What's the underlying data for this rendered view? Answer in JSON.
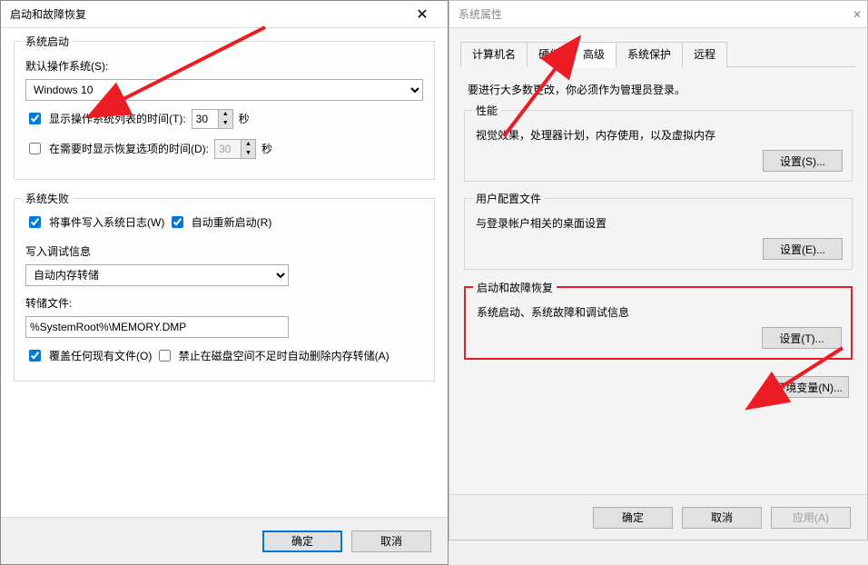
{
  "left_dialog": {
    "title": "启动和故障恢复",
    "group_startup": {
      "legend": "系统启动",
      "default_os_label": "默认操作系统(S):",
      "os_selected": "Windows 10",
      "show_list_label": "显示操作系统列表的时间(T):",
      "show_list_checked": true,
      "show_list_value": "30",
      "show_recovery_label": "在需要时显示恢复选项的时间(D):",
      "show_recovery_checked": false,
      "show_recovery_value": "30",
      "seconds_suffix": "秒"
    },
    "group_failure": {
      "legend": "系统失败",
      "write_log_label": "将事件写入系统日志(W)",
      "write_log_checked": true,
      "auto_restart_label": "自动重新启动(R)",
      "auto_restart_checked": true,
      "debug_heading": "写入调试信息",
      "dump_type_selected": "自动内存转储",
      "dump_file_label": "转储文件:",
      "dump_file_value": "%SystemRoot%\\MEMORY.DMP",
      "overwrite_label": "覆盖任何现有文件(O)",
      "overwrite_checked": true,
      "no_dump_low_space_label": "禁止在磁盘空间不足时自动删除内存转储(A)",
      "no_dump_low_space_checked": false
    },
    "ok": "确定",
    "cancel": "取消"
  },
  "right_dialog": {
    "title": "系统属性",
    "tabs": {
      "t0": "计算机名",
      "t1": "硬件",
      "t2": "高级",
      "t3": "系统保护",
      "t4": "远程"
    },
    "admin_note": "要进行大多数更改，你必须作为管理员登录。",
    "group_perf": {
      "legend": "性能",
      "desc": "视觉效果，处理器计划，内存使用，以及虚拟内存",
      "btn": "设置(S)..."
    },
    "group_profile": {
      "legend": "用户配置文件",
      "desc": "与登录帐户相关的桌面设置",
      "btn": "设置(E)..."
    },
    "group_recovery": {
      "legend": "启动和故障恢复",
      "desc": "系统启动、系统故障和调试信息",
      "btn": "设置(T)..."
    },
    "env_btn": "环境变量(N)...",
    "ok": "确定",
    "cancel": "取消",
    "apply": "应用(A)"
  }
}
